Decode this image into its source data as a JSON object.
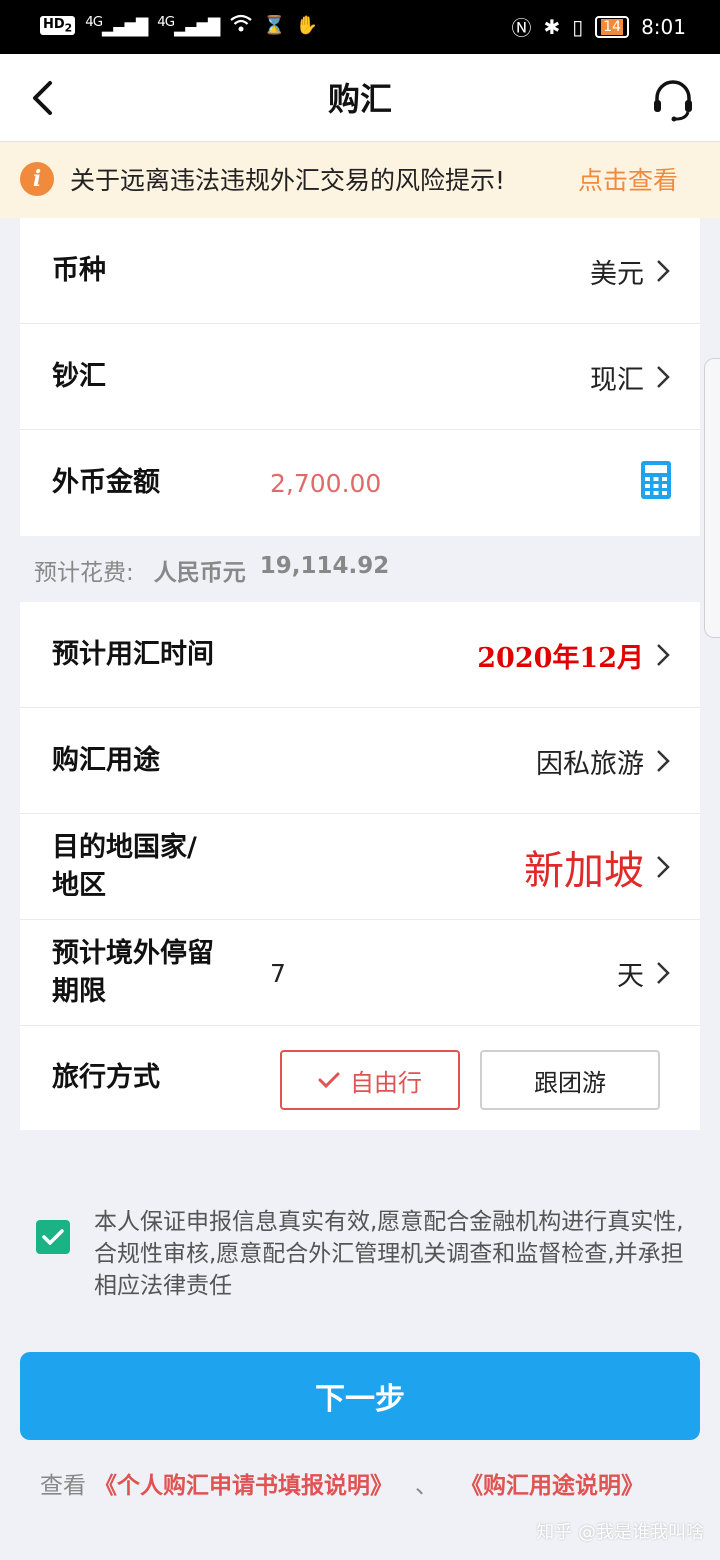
{
  "statusbar": {
    "hd": "HD",
    "hd_sub": "2",
    "signal1": "4G",
    "signal2": "4G",
    "battery": "14",
    "time": "8:01"
  },
  "header": {
    "title": "购汇"
  },
  "notice": {
    "text": "关于远离违法违规外汇交易的风险提示!",
    "link": "点击查看"
  },
  "currency_card": {
    "currency_label": "币种",
    "currency_value": "美元",
    "type_label": "钞汇",
    "type_value": "现汇",
    "amount_label": "外币金额",
    "amount_value": "2,700.00"
  },
  "estimate": {
    "label": "预计花费:",
    "currency": "人民币元",
    "amount": "19,114.92"
  },
  "details_card": {
    "time_label": "预计用汇时间",
    "time_value": "2020年12月",
    "purpose_label": "购汇用途",
    "purpose_value": "因私旅游",
    "destination_label_line1": "目的地国家/",
    "destination_label_line2": "地区",
    "destination_value": "新加坡",
    "stay_label_line1": "预计境外停留",
    "stay_label_line2": "期限",
    "stay_value": "7",
    "stay_unit": "天",
    "travel_label": "旅行方式",
    "travel_option_selected": "自由行",
    "travel_option_other": "跟团游"
  },
  "agreement": {
    "text": "本人保证申报信息真实有效,愿意配合金融机构进行真实性,合规性审核,愿意配合外汇管理机关调查和监督检查,并承担相应法律责任",
    "checked": true
  },
  "next_button": "下一步",
  "bottom": {
    "view": "查看",
    "link1": "《个人购汇申请书填报说明》",
    "separator": "、",
    "link2": "《购汇用途说明》"
  },
  "watermark": "知乎 @我是谁我叫啥",
  "colors": {
    "accent_blue": "#1ea3ee",
    "accent_orange": "#f08a3c",
    "accent_red": "#e05353",
    "check_green": "#1bb386"
  }
}
